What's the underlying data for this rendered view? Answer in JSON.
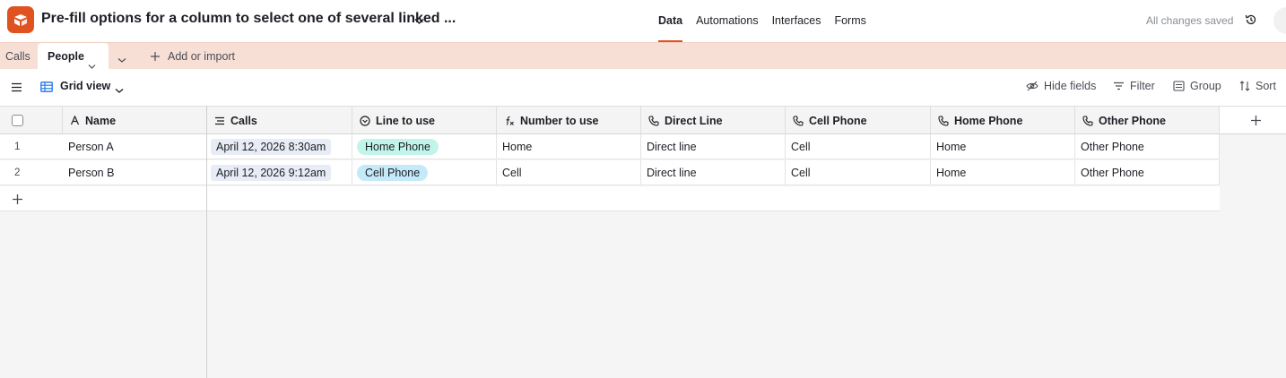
{
  "topbar": {
    "base_title": "Pre-fill options for a column to select one of several linked ...",
    "nav": [
      "Data",
      "Automations",
      "Interfaces",
      "Forms"
    ],
    "status": "All changes saved"
  },
  "tabs": {
    "items": [
      "Calls",
      "People"
    ],
    "add_label": "Add or import"
  },
  "viewbar": {
    "view_name": "Grid view",
    "tools": [
      "Hide fields",
      "Filter",
      "Group",
      "Sort"
    ]
  },
  "grid": {
    "columns": [
      "Name",
      "Calls",
      "Line to use",
      "Number to use",
      "Direct Line",
      "Cell Phone",
      "Home Phone",
      "Other Phone"
    ],
    "rows": [
      {
        "num": "1",
        "name": "Person A",
        "calls": "April 12, 2026 8:30am",
        "line_to_use": "Home Phone",
        "number_to_use": "Home",
        "direct_line": "Direct line",
        "cell_phone": "Cell",
        "home_phone": "Home",
        "other_phone": "Other Phone"
      },
      {
        "num": "2",
        "name": "Person B",
        "calls": "April 12, 2026 9:12am",
        "line_to_use": "Cell Phone",
        "number_to_use": "Cell",
        "direct_line": "Direct line",
        "cell_phone": "Cell",
        "home_phone": "Home",
        "other_phone": "Other Phone"
      }
    ]
  },
  "colors": {
    "brand": "#e0521f",
    "tabs_bg": "#f8dfd6",
    "pill_home": "#c2f5e9",
    "pill_cell": "#c4e9f8",
    "link_chip": "#e7ecf5"
  },
  "icons": [
    "base-logo-icon",
    "chevron-down-icon",
    "history-icon",
    "plus-icon",
    "menu-icon",
    "grid-view-icon",
    "eye-off-icon",
    "filter-icon",
    "group-icon",
    "sort-icon",
    "text-field-icon",
    "linked-record-icon",
    "single-select-icon",
    "formula-icon",
    "phone-icon"
  ]
}
